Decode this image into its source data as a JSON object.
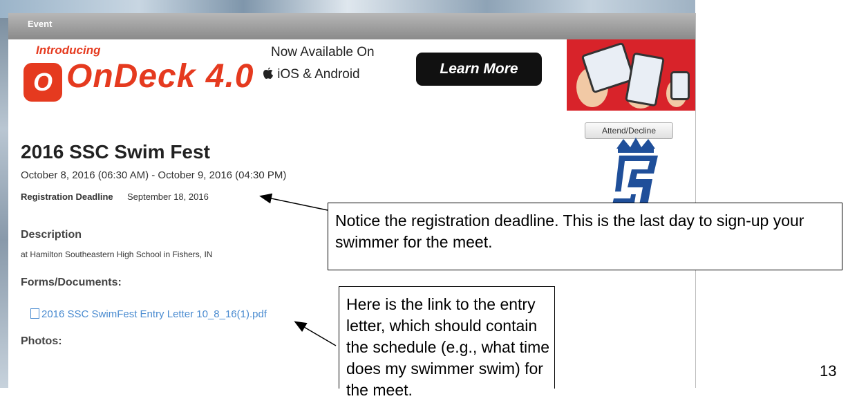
{
  "header": {
    "title": "Event"
  },
  "banner": {
    "intro": "Introducing",
    "logo_letter": "O",
    "brand": "OnDeck 4.0",
    "available_line1": "Now Available On",
    "available_line2": "iOS & Android",
    "apple_icon": "apple-icon",
    "android_icon": "android-icon",
    "learn_more_label": "Learn More",
    "accent_color": "#e53a1f"
  },
  "actions": {
    "attend_decline_label": "Attend/Decline"
  },
  "event": {
    "title": "2016 SSC Swim Fest",
    "dates": "October 8, 2016 (06:30 AM) - October 9, 2016 (04:30 PM)",
    "registration_label": "Registration Deadline",
    "registration_value": "September 18, 2016",
    "description_heading": "Description",
    "description_text": "at Hamilton Southeastern High School in Fishers, IN",
    "forms_heading": "Forms/Documents:",
    "document_link": "2016 SSC SwimFest Entry Letter 10_8_16(1).pdf",
    "photos_heading": "Photos:",
    "link_color": "#4a8bd0"
  },
  "annotations": {
    "deadline_note": "Notice the registration deadline.  This is the last day to sign-up your swimmer for the meet.",
    "entry_letter_note": "Here is the link to the entry letter, which should contain the schedule (e.g., what time does my swimmer swim) for the meet."
  },
  "page_number": "13"
}
